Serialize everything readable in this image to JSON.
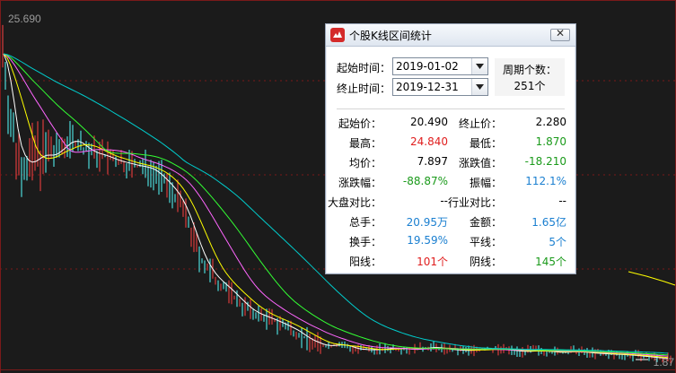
{
  "chart": {
    "max_price_label": "25.690",
    "min_price_label": "1.87",
    "colors": {
      "background": "#1b1b1b",
      "up_candle": "#ff4040",
      "down_candle": "#54ffff",
      "ma5": "#ffffff",
      "ma10": "#ffff00",
      "ma20": "#ff66ff",
      "ma30": "#33ff33",
      "ma60": "#00cccc",
      "grid": "#7a1a1a"
    }
  },
  "dialog": {
    "title": "个股K线区间统计",
    "close_symbol": "✕",
    "start_label": "起始时间：",
    "start_value": "2019-01-02",
    "end_label": "终止时间：",
    "end_value": "2019-12-31",
    "period_label": "周期个数：",
    "period_value": "251个",
    "stats": {
      "start_price_label": "起始价：",
      "start_price": "20.490",
      "end_price_label": "终止价：",
      "end_price": "2.280",
      "high_label": "最高：",
      "high": "24.840",
      "low_label": "最低：",
      "low": "1.870",
      "avg_label": "均价：",
      "avg": "7.897",
      "change_label": "涨跌值：",
      "change": "-18.210",
      "pct_label": "涨跌幅：",
      "pct": "-88.87%",
      "amplitude_label": "振幅：",
      "amplitude": "112.1%",
      "market_cmp_label": "大盘对比：",
      "market_cmp": "--",
      "industry_cmp_label": "行业对比：",
      "industry_cmp": "--",
      "volume_label": "总手：",
      "volume": "20.95万",
      "amount_label": "金额：",
      "amount": "1.65亿",
      "turnover_label": "换手：",
      "turnover": "19.59%",
      "flat_label": "平线：",
      "flat": "5个",
      "up_label": "阳线：",
      "up": "101个",
      "down_label": "阴线：",
      "down": "145个"
    }
  }
}
